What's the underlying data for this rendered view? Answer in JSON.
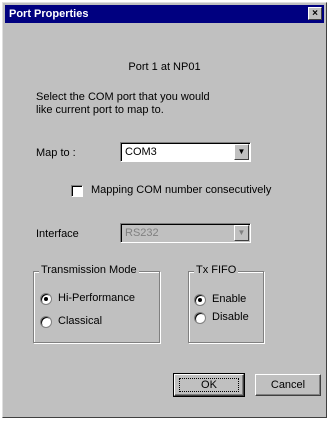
{
  "window": {
    "title": "Port Properties",
    "close_glyph": "×"
  },
  "port_label": "Port 1 at NP01",
  "instructions": "Select the COM port that you would\nlike current port to map to.",
  "map_to": {
    "label": "Map to :",
    "value": "COM3"
  },
  "mapping_checkbox": {
    "label": "Mapping COM number consecutively",
    "checked": false
  },
  "interface": {
    "label": "Interface",
    "value": "RS232",
    "disabled": true
  },
  "transmission_mode": {
    "title": "Transmission Mode",
    "options": [
      {
        "label": "Hi-Performance",
        "selected": true
      },
      {
        "label": "Classical",
        "selected": false
      }
    ]
  },
  "tx_fifo": {
    "title": "Tx FIFO",
    "options": [
      {
        "label": "Enable",
        "selected": true
      },
      {
        "label": "Disable",
        "selected": false
      }
    ]
  },
  "buttons": {
    "ok": "OK",
    "cancel": "Cancel"
  }
}
